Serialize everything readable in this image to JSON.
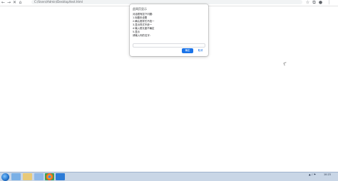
{
  "browser": {
    "address_text": "C:/Users/Admin/Desktop/test.html",
    "icons": [
      "back-icon",
      "forward-icon",
      "close-icon",
      "home-icon"
    ]
  },
  "dialog": {
    "title": "此网页显示",
    "lines": [
      "对话框有如下问题:",
      "1.标题未设置",
      "2.确认框样式不统一",
      "3.显示样式不统一",
      "4.输入框长度不确定",
      "5.显示",
      "请输入你的名字:"
    ],
    "input_value": "",
    "ok_label": "确定",
    "cancel_label": "取消",
    "accent_color": "#1a73e8"
  },
  "taskbar": {
    "apps": [
      "ie-icon",
      "explorer-icon",
      "media-player-icon",
      "chrome-icon",
      "vscode-icon"
    ],
    "clock": "10:23"
  }
}
